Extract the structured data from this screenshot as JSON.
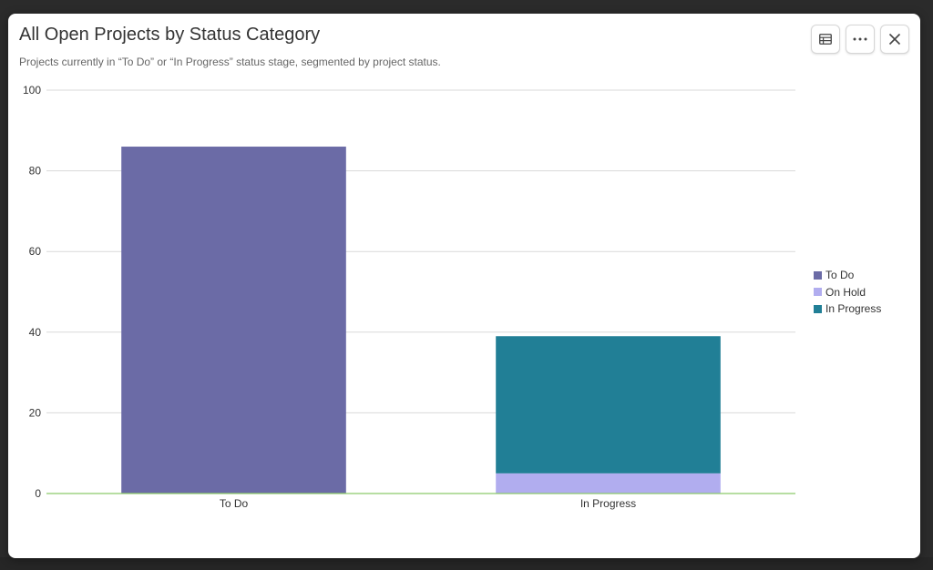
{
  "modal": {
    "title": "All Open Projects by Status Category",
    "subtitle": "Projects currently in “To Do” or “In Progress” status stage, segmented by project status."
  },
  "toolbar": {
    "buttons": [
      {
        "name": "table-view-button",
        "icon": "table-icon"
      },
      {
        "name": "more-options-button",
        "icon": "more-horizontal-icon"
      },
      {
        "name": "close-button",
        "icon": "close-icon"
      }
    ]
  },
  "colors": {
    "to_do": "#6b6ba6",
    "on_hold": "#b1adef",
    "in_progress": "#217f96",
    "gridline": "#d9d9d9",
    "baseline": "#8cc96a",
    "axis_text": "#333333"
  },
  "chart_data": {
    "type": "bar",
    "stacked": true,
    "title": "All Open Projects by Status Category",
    "subtitle": "Projects currently in “To Do” or “In Progress” status stage, segmented by project status.",
    "categories": [
      "To Do",
      "In Progress"
    ],
    "series": [
      {
        "name": "To Do",
        "color": "#6b6ba6",
        "values": [
          86,
          0
        ]
      },
      {
        "name": "On Hold",
        "color": "#b1adef",
        "values": [
          0,
          5
        ]
      },
      {
        "name": "In Progress",
        "color": "#217f96",
        "values": [
          0,
          34
        ]
      }
    ],
    "ylim": [
      0,
      100
    ],
    "yticks": [
      0,
      20,
      40,
      60,
      80,
      100
    ],
    "xlabel": "",
    "ylabel": "",
    "grid": true,
    "legend_position": "right"
  }
}
